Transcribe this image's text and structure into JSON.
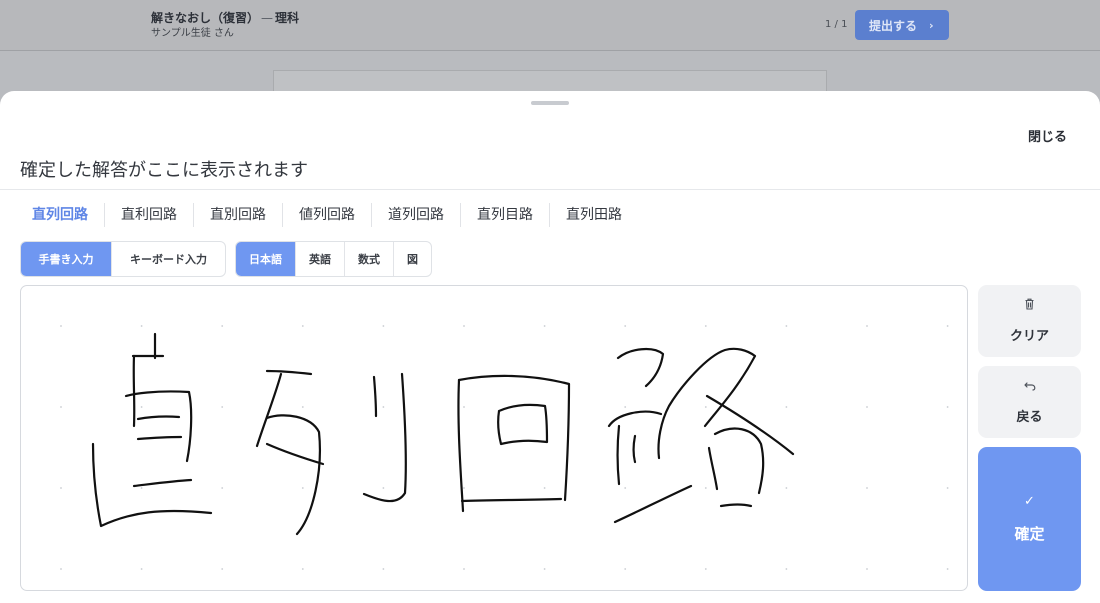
{
  "app": {
    "title": "解きなおし（復習）",
    "subject": "理科",
    "student": "サンプル生徒 さん",
    "page_counter": "1 / 1",
    "submit_label": "提出する"
  },
  "sheet": {
    "close_label": "閉じる",
    "answer_preview": "確定した解答がここに表示されます",
    "candidates": [
      "直列回路",
      "直利回路",
      "直別回路",
      "値列回路",
      "道列回路",
      "直列目路",
      "直列田路"
    ],
    "selected_candidate": 0,
    "input_modes": [
      "手書き入力",
      "キーボード入力"
    ],
    "active_input_mode": 0,
    "languages": [
      "日本語",
      "英語",
      "数式",
      "図"
    ],
    "active_language": 0,
    "buttons": {
      "clear_label": "クリア",
      "undo_label": "戻る",
      "confirm_label": "確定"
    }
  },
  "icons": {
    "clear": "trash-icon",
    "undo": "undo-icon",
    "confirm": "check-icon",
    "submit": "chevron-right-icon"
  },
  "colors": {
    "accent": "#6f97f1",
    "submit_dimmed": "#5b7fcf",
    "selected_candidate_text": "#5f86e6"
  }
}
